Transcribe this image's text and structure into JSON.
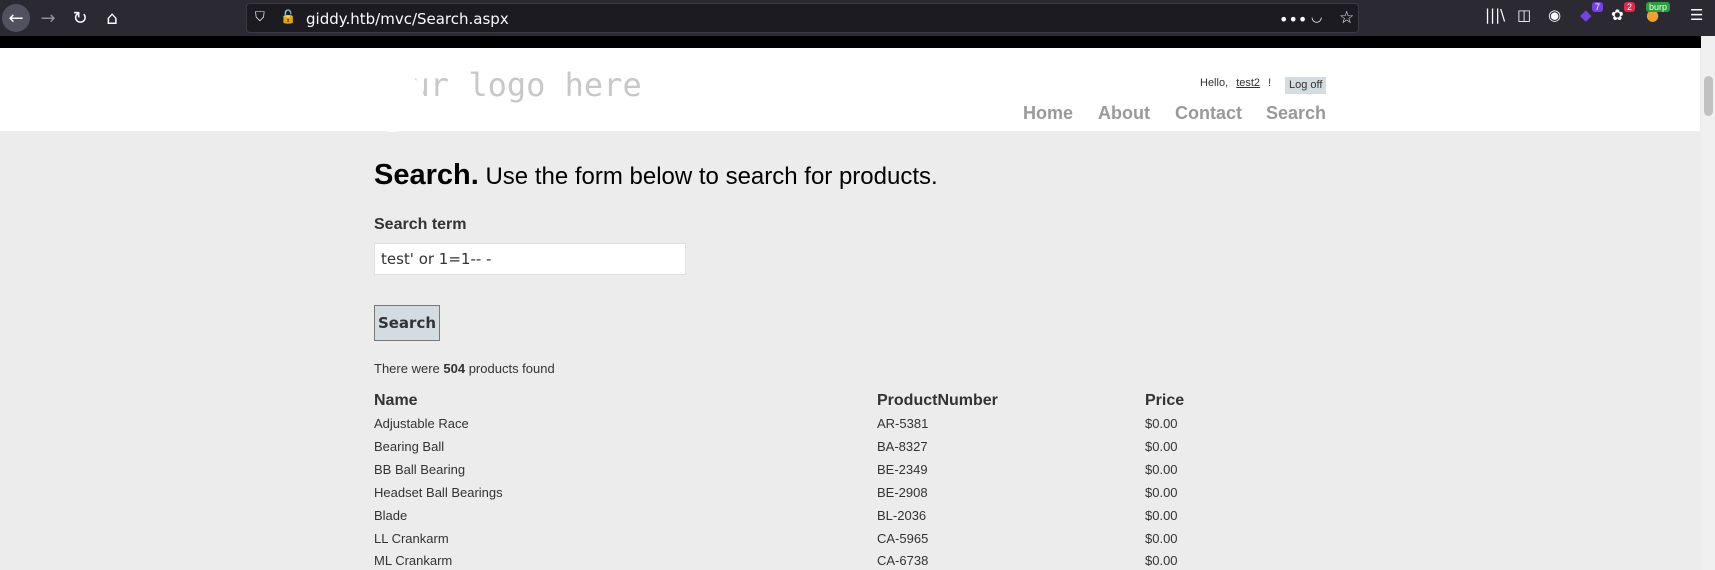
{
  "browser": {
    "url": "giddy.htb/mvc/Search.aspx",
    "icons": [
      "back-icon",
      "forward-icon",
      "reload-icon",
      "home-icon",
      "shield-icon",
      "insecure-lock-icon",
      "more-icon",
      "pocket-icon",
      "bookmark-star-icon",
      "library-icon",
      "sidebar-icon",
      "account-icon",
      "extension-icon",
      "extension-icon",
      "burp-icon",
      "menu-icon"
    ],
    "badges": {
      "ext1": "7",
      "ext2": "2",
      "burp": "burp"
    }
  },
  "site": {
    "logo": "your logo here",
    "greeting": "Hello,",
    "username": "test2",
    "greeting_end": "!",
    "logoff": "Log off",
    "nav": [
      "Home",
      "About",
      "Contact",
      "Search"
    ]
  },
  "page": {
    "title_bold": "Search.",
    "title_rest": "Use the form below to search for products.",
    "search_label": "Search term",
    "search_value": "test' or 1=1-- -",
    "search_button": "Search",
    "count_prefix": "There were",
    "count_value": "504",
    "count_suffix": "products found"
  },
  "table": {
    "headers": [
      "Name",
      "ProductNumber",
      "Price"
    ],
    "rows": [
      [
        "Adjustable Race",
        "AR-5381",
        "$0.00"
      ],
      [
        "Bearing Ball",
        "BA-8327",
        "$0.00"
      ],
      [
        "BB Ball Bearing",
        "BE-2349",
        "$0.00"
      ],
      [
        "Headset Ball Bearings",
        "BE-2908",
        "$0.00"
      ],
      [
        "Blade",
        "BL-2036",
        "$0.00"
      ],
      [
        "LL Crankarm",
        "CA-5965",
        "$0.00"
      ],
      [
        "ML Crankarm",
        "CA-6738",
        "$0.00"
      ]
    ]
  }
}
